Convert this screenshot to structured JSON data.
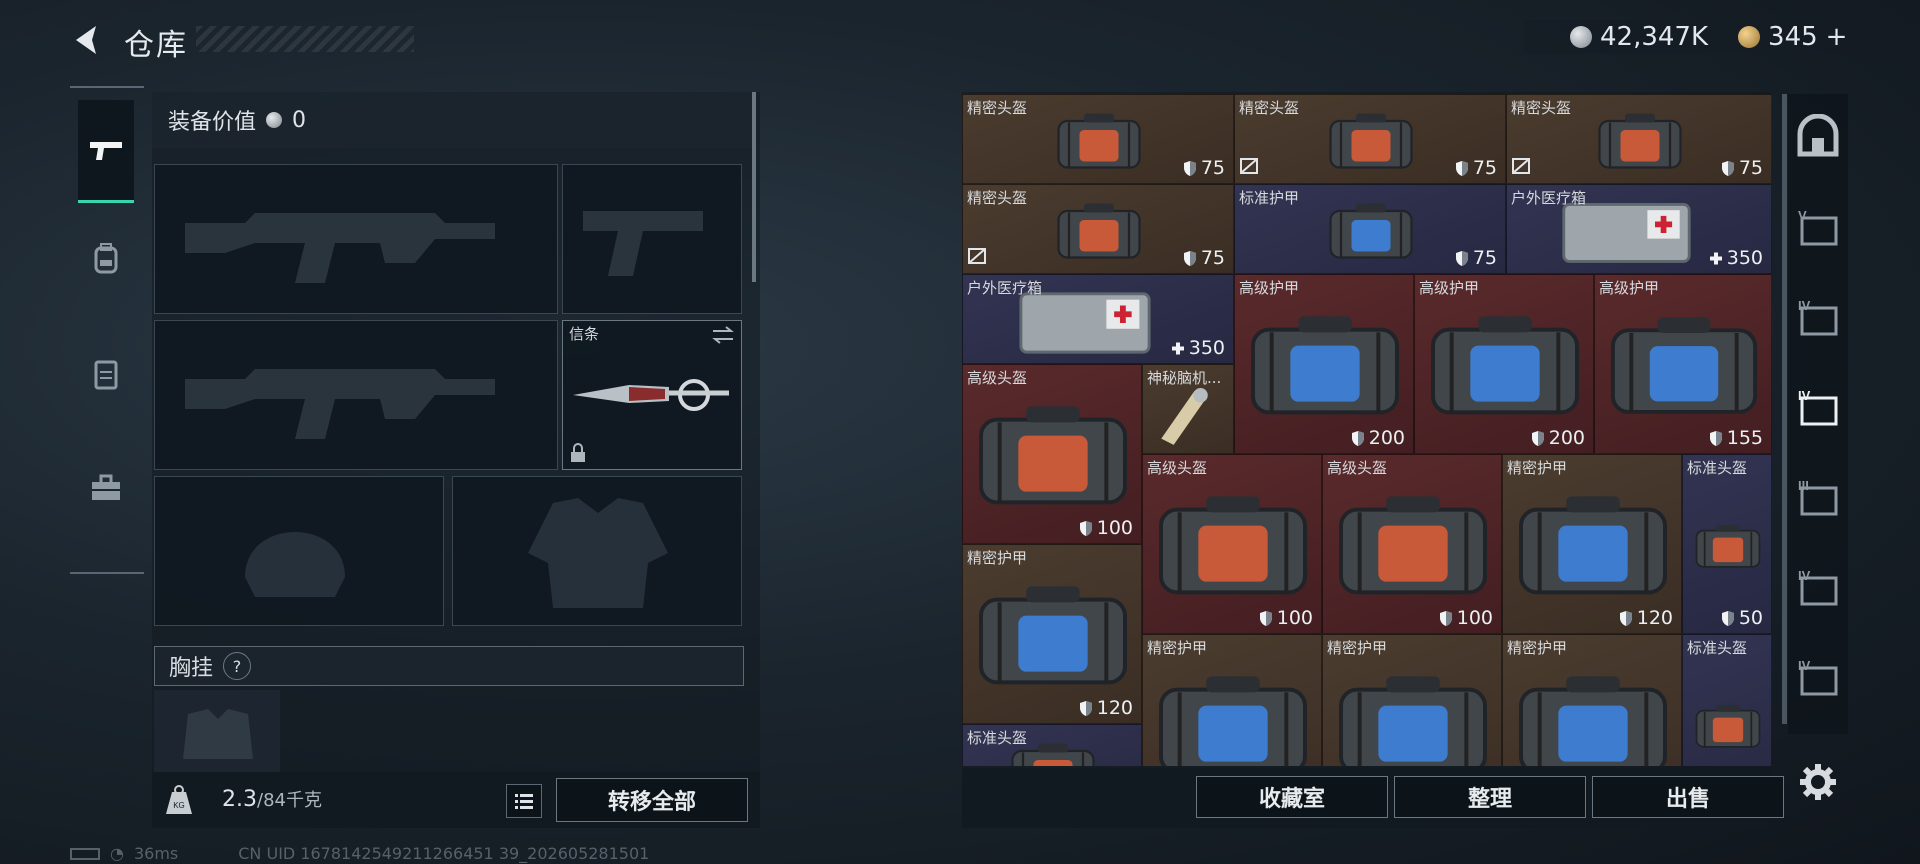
{
  "header": {
    "title": "仓库"
  },
  "currency": {
    "silver": "42,347K",
    "gold": "345",
    "plus": "+"
  },
  "left_tabs": [
    "weapon-tab",
    "backpack-tab",
    "armor-tab",
    "toolbox-tab"
  ],
  "equipment": {
    "value_label": "装备价值",
    "value": "0",
    "knife_label": "信条"
  },
  "chest_rig": {
    "label": "胸挂",
    "help": "?"
  },
  "footer_left": {
    "weight": "2.3",
    "capacity": "/84千克",
    "transfer_all": "转移全部",
    "weight_icon_text": "KG"
  },
  "status": {
    "ping": "36ms",
    "uid": "CN UID 1678142549211266451 39_202605281501"
  },
  "inventory": [
    {
      "name": "精密头盔",
      "value": "75",
      "color": "gold",
      "broken": false
    },
    {
      "name": "精密头盔",
      "value": "75",
      "color": "gold",
      "broken": true
    },
    {
      "name": "精密头盔",
      "value": "75",
      "color": "gold",
      "broken": true
    },
    {
      "name": "精密头盔",
      "value": "75",
      "color": "gold",
      "broken": true
    },
    {
      "name": "标准护甲",
      "value": "75",
      "color": "blue",
      "broken": false
    },
    {
      "name": "户外医疗箱",
      "value": "350",
      "color": "blue",
      "broken": false
    },
    {
      "name": "户外医疗箱",
      "value": "350",
      "color": "blue",
      "broken": false
    },
    {
      "name": "高级护甲",
      "value": "",
      "color": "red",
      "broken": false
    },
    {
      "name": "高级护甲",
      "value": "200",
      "color": "red",
      "broken": false
    },
    {
      "name": "高级护甲",
      "value": "200",
      "color": "red",
      "broken": false
    },
    {
      "name": "高级护甲",
      "value": "155",
      "color": "red",
      "broken": false
    },
    {
      "name": "高级头盔",
      "value": "100",
      "color": "red",
      "broken": false
    },
    {
      "name": "神秘脑机...",
      "value": "",
      "color": "gold",
      "broken": false
    },
    {
      "name": "高级头盔",
      "value": "100",
      "color": "red",
      "broken": false
    },
    {
      "name": "高级头盔",
      "value": "100",
      "color": "red",
      "broken": false
    },
    {
      "name": "精密护甲",
      "value": "120",
      "color": "gold",
      "broken": false
    },
    {
      "name": "标准头盔",
      "value": "50",
      "color": "blue",
      "broken": false
    },
    {
      "name": "精密护甲",
      "value": "120",
      "color": "gold",
      "broken": false
    },
    {
      "name": "精密护甲",
      "value": "",
      "color": "gold",
      "broken": false
    },
    {
      "name": "精密护甲",
      "value": "",
      "color": "gold",
      "broken": false
    },
    {
      "name": "精密护甲",
      "value": "",
      "color": "gold",
      "broken": false
    },
    {
      "name": "标准头盔",
      "value": "",
      "color": "blue",
      "broken": false
    },
    {
      "name": "标准头盔",
      "value": "",
      "color": "blue",
      "broken": false
    }
  ],
  "right_tabs": [
    "safe-box-tab",
    "tier-v-tab",
    "tier-iv-tab",
    "tier-iv-add-tab",
    "tier-iii-tab",
    "tier-iv-bag-tab",
    "tier-iv-card-tab"
  ],
  "right_tab_labels": [
    "",
    "V",
    "IV",
    "IV",
    "III",
    "IV",
    "IV"
  ],
  "footer_right": {
    "collection": "收藏室",
    "sort": "整理",
    "sell": "出售"
  }
}
